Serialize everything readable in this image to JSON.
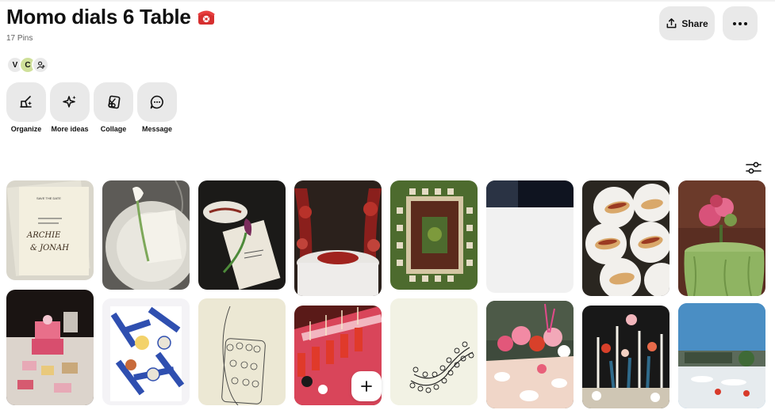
{
  "board": {
    "title": "Momo dials 6 Table",
    "title_icon": "telephone-emoji",
    "pins_count": "17 Pins"
  },
  "collaborators": [
    {
      "initial": "V",
      "color": "#e9e9e9"
    },
    {
      "initial": "C",
      "color": "#cfe09a"
    }
  ],
  "actions": [
    {
      "label": "Organize",
      "icon": "organize-icon"
    },
    {
      "label": "More ideas",
      "icon": "sparkle-icon"
    },
    {
      "label": "Collage",
      "icon": "collage-icon"
    },
    {
      "label": "Message",
      "icon": "message-icon"
    }
  ],
  "header": {
    "share_label": "Share",
    "share_icon": "share-icon",
    "more_icon": "ellipsis-icon"
  },
  "filter_icon": "sliders-icon",
  "pins": [
    {
      "name": "save-the-date-card",
      "description": "Save the date card with handwritten names",
      "lettering": [
        "SAVE  THE  DATE",
        "ARCHIE",
        "& JONAH"
      ]
    },
    {
      "name": "white-plate-calla-lily",
      "description": "White plate with menu card and calla lily"
    },
    {
      "name": "dark-table-purple-flower",
      "description": "Dark table setting with menu and purple flower"
    },
    {
      "name": "red-floral-round-table",
      "description": "Red floral installation around a round table"
    },
    {
      "name": "aerial-square-table",
      "description": "Aerial view of square table on grass"
    },
    {
      "name": "loading-pin",
      "description": "Partially loaded pin image"
    },
    {
      "name": "hot-dogs-on-paper",
      "description": "Hot dogs served on paper liners"
    },
    {
      "name": "green-table-flowers",
      "description": "Table with green cloth and pink flowers"
    },
    {
      "name": "cake-dessert-table",
      "description": "Cake and dessert table at night"
    },
    {
      "name": "blue-table-illustration",
      "description": "Blue and white table illustration"
    },
    {
      "name": "table-sketch",
      "description": "Pencil sketch of long table"
    },
    {
      "name": "red-long-table",
      "description": "Long red banquet table"
    },
    {
      "name": "curved-table-sketch",
      "description": "Line drawing of curved table with chairs"
    },
    {
      "name": "pink-floral-table",
      "description": "Pink floral table arrangement"
    },
    {
      "name": "candles-flowers-table",
      "description": "Dark table with candles and flowers"
    },
    {
      "name": "outdoor-table-blue-sky",
      "description": "Outdoor table under blue sky"
    }
  ]
}
